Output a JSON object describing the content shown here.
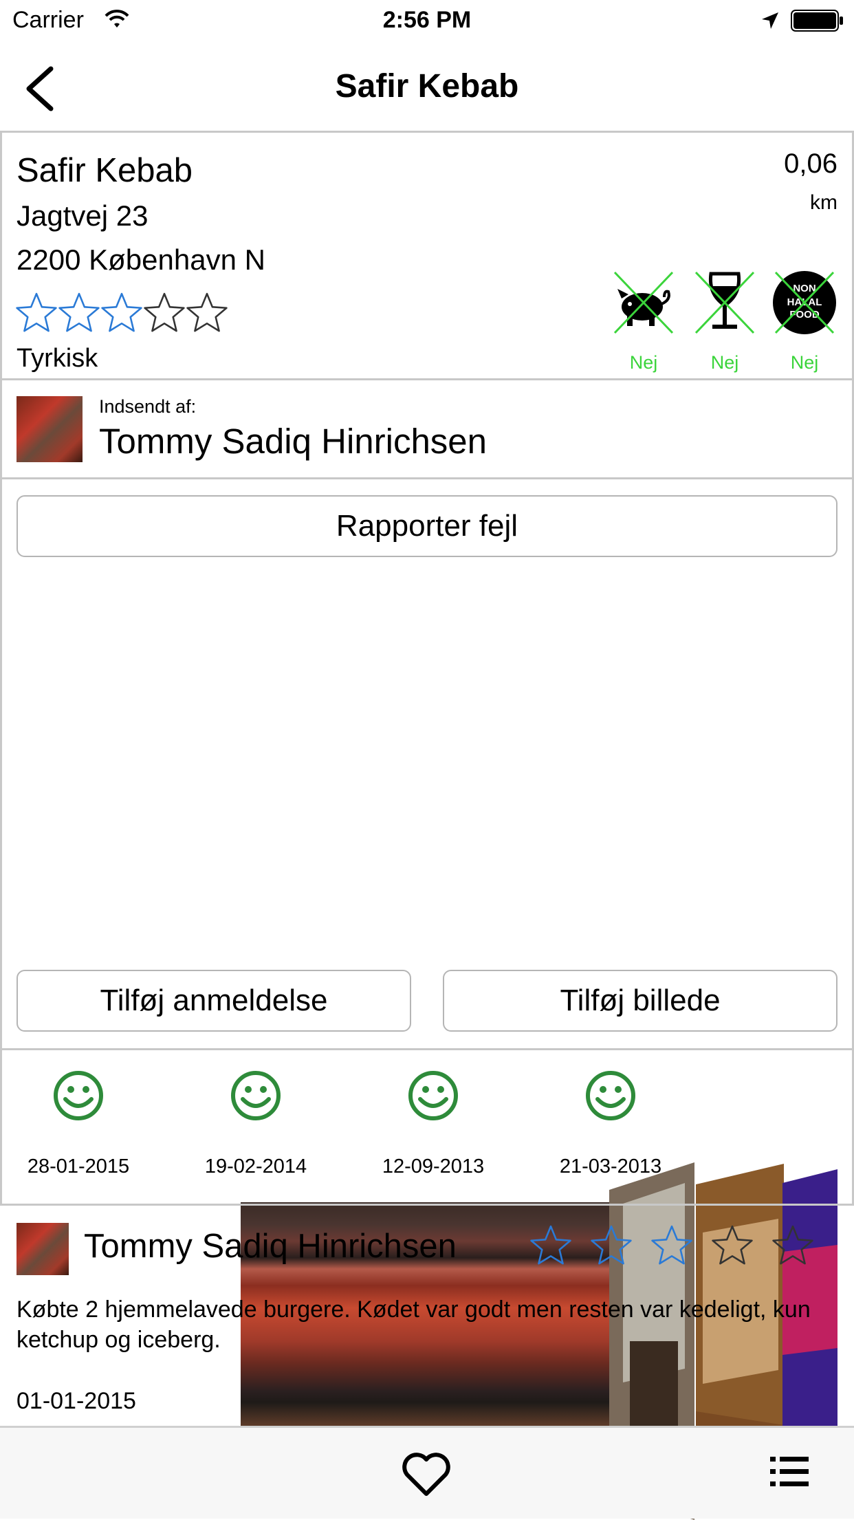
{
  "status_bar": {
    "carrier": "Carrier",
    "time": "2:56 PM"
  },
  "nav": {
    "title": "Safir Kebab"
  },
  "restaurant": {
    "name": "Safir Kebab",
    "street": "Jagtvej  23",
    "city": "2200 København N",
    "distance": "0,06",
    "distance_unit": "km",
    "rating": 3,
    "rating_max": 5,
    "cuisine": "Tyrkisk",
    "diet": [
      {
        "icon": "pig-icon",
        "label": "Nej"
      },
      {
        "icon": "wine-glass-icon",
        "label": "Nej"
      },
      {
        "icon": "non-halal-food-icon",
        "label": "Nej",
        "badge_text": "NON HALAL FOOD"
      }
    ]
  },
  "submitted": {
    "label": "Indsendt af:",
    "name": "Tommy Sadiq Hinrichsen"
  },
  "buttons": {
    "report_error": "Rapporter fejl",
    "add_review": "Tilføj anmeldelse",
    "add_photo": "Tilføj billede"
  },
  "inspection_history": [
    {
      "icon": "smiley-icon",
      "date": "28-01-2015"
    },
    {
      "icon": "smiley-icon",
      "date": "19-02-2014"
    },
    {
      "icon": "smiley-icon",
      "date": "12-09-2013"
    },
    {
      "icon": "smiley-icon",
      "date": "21-03-2013"
    }
  ],
  "review": {
    "author": "Tommy Sadiq Hinrichsen",
    "rating": 3,
    "rating_max": 5,
    "text": "Købte 2 hjemmelavede burgere. Kødet var godt men resten var kedeligt, kun ketchup og iceberg.",
    "date": "01-01-2015"
  },
  "colors": {
    "star_blue": "#2a7ad6",
    "diet_green": "#3bd43b",
    "smiley_green": "#2e8b3a"
  }
}
